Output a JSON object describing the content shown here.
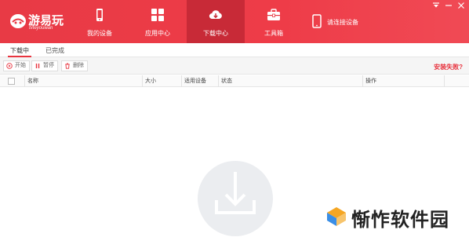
{
  "app": {
    "logo_text": "游易玩",
    "logo_sub": "tvteyouwan"
  },
  "nav": [
    {
      "label": "我的设备",
      "icon": "phone-icon"
    },
    {
      "label": "应用中心",
      "icon": "grid-icon"
    },
    {
      "label": "下载中心",
      "icon": "cloud-download-icon",
      "active": true
    },
    {
      "label": "工具箱",
      "icon": "toolbox-icon"
    }
  ],
  "connect": {
    "label": "请连接设备",
    "icon": "phone-icon"
  },
  "tabs": [
    {
      "label": "下载中",
      "active": true
    },
    {
      "label": "已完成"
    }
  ],
  "toolbar": {
    "start_label": "开始",
    "pause_label": "暂停",
    "delete_label": "删除",
    "fail_label": "安装失败?"
  },
  "table": {
    "headers": [
      "名称",
      "大小",
      "适用设备",
      "状态",
      "操作"
    ]
  },
  "watermark": {
    "text": "惭怍软件园"
  },
  "colors": {
    "brand": "#e83a45",
    "active_nav": "#c82a37",
    "accent_text": "#e8343f"
  }
}
